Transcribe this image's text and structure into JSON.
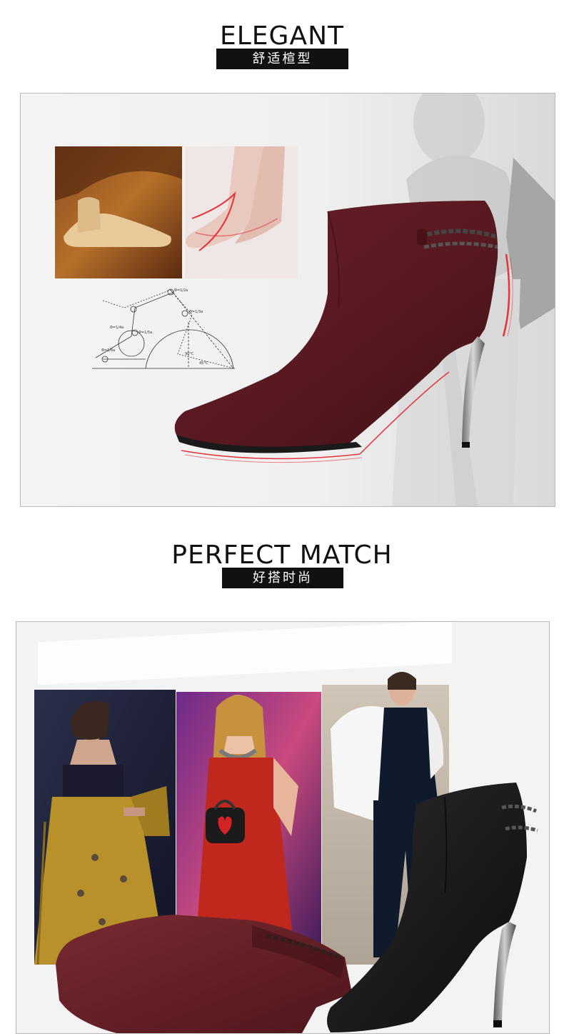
{
  "section1": {
    "title": "ELEGANT",
    "subtitle": "舒适楦型",
    "diagram_labels": {
      "a": "Φ=1/2a",
      "b": "Φ=1/3a",
      "c": "Φ=1/4a",
      "d": "Φ=1/5a",
      "e": "Φ=1/6a",
      "angle90": "90°C",
      "angle45": "45°C"
    },
    "colors": {
      "boot": "#5e1a22",
      "accent_line": "#e4353b"
    }
  },
  "section2": {
    "title": "PERFECT MATCH",
    "subtitle": "好搭时尚",
    "colors": {
      "boot_red": "#6e2126",
      "boot_black": "#1a1a1a",
      "dress_red": "#c0281e",
      "skirt_gold": "#b9912a"
    }
  }
}
